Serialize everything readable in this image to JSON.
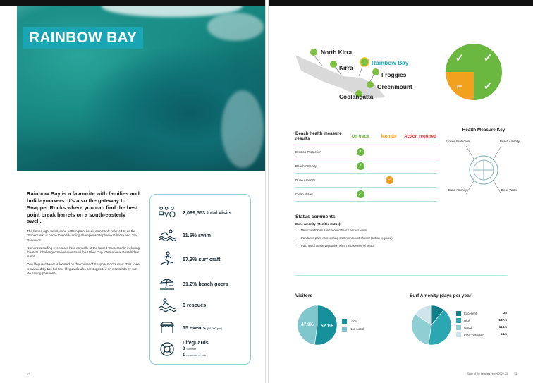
{
  "left_page": {
    "title": "RAINBOW BAY",
    "intro_lead": "Rainbow Bay is a favourite with families and holidaymakers. It’s also the gateway to Snapper Rocks where you can find the best point break barrels on a south-easterly swell.",
    "paragraphs": [
      "The famed right hand, sand-bottom point break commonly referred to as the “Superbank” is home to world-surfing champions Stephanie Gilmore and Joel Parkinson.",
      "Numerous surfing events are held annually at the famed “Superbank” including the WSL Challenger Series event and the Usher Cup International Boardriders event.",
      "One lifeguard tower is located on the corner of Snapper Rocks road. This tower is manned by two full time lifeguards who are supported on weekends by surf life saving personnel."
    ],
    "stats": [
      {
        "icon": "people-icon",
        "text": "2,099,553 total visits",
        "note": ""
      },
      {
        "icon": "swimmer-icon",
        "text": "11.5% swim",
        "note": ""
      },
      {
        "icon": "surfer-icon",
        "text": "57.3% surf craft",
        "note": ""
      },
      {
        "icon": "umbrella-icon",
        "text": "31.2% beach goers",
        "note": ""
      },
      {
        "icon": "rescue-icon",
        "text": "6 rescues",
        "note": ""
      },
      {
        "icon": "event-tent-icon",
        "text": "15 events",
        "note": "(50,000 pax)"
      }
    ],
    "lifeguards": {
      "icon": "lifebuoy-icon",
      "title": "Lifeguards",
      "summer_num": "3",
      "summer_label": "Summer",
      "rest_num": "1",
      "rest_label": "remainder of year"
    },
    "page_number": "12"
  },
  "right_page": {
    "map_labels": [
      "North Kirra",
      "Kirra",
      "Rainbow Bay",
      "Froggies",
      "Greenmount",
      "Coolangatta"
    ],
    "highlight_color": "#1aa5b5",
    "health_table": {
      "headers": [
        "Beach health measure results",
        "On track",
        "Monitor",
        "Action required"
      ],
      "header_colors": [
        "#1b1b1b",
        "#6ab83f",
        "#f2a11e",
        "#e23a3a"
      ],
      "rows": [
        {
          "label": "Erosion Protection",
          "status": "on_track"
        },
        {
          "label": "Beach Amenity",
          "status": "on_track"
        },
        {
          "label": "Dune Amenity",
          "status": "monitor"
        },
        {
          "label": "Clean Water",
          "status": "on_track"
        }
      ]
    },
    "key": {
      "title": "Health Measure Key",
      "labels": [
        "Erosion Protection",
        "Beach Amenity",
        "Dune Amenity",
        "Clean Water"
      ]
    },
    "status": {
      "title": "Status comments",
      "subtitle": "Dune amenity (Monitor status):",
      "items": [
        "Minor windblown sand around beach access ways",
        "Pandanus palm encroaching on Greenmount shower (action required)",
        "Patches of dense vegetation within mid section of beach"
      ]
    },
    "footer": "State of the beaches report 2022-23",
    "page_number": "13"
  },
  "chart_data": [
    {
      "type": "pie",
      "title": "Visitors",
      "categories": [
        "Local",
        "Non Local"
      ],
      "values": [
        52.1,
        47.9
      ],
      "labels": [
        "52.1%",
        "47.9%"
      ],
      "colors": [
        "#16919c",
        "#7fc7cd"
      ]
    },
    {
      "type": "pie",
      "title": "Surf Amenity (days per year)",
      "categories": [
        "Excellent",
        "High",
        "Good",
        "Poor-Average"
      ],
      "values": [
        38,
        147.5,
        113.5,
        54.5
      ],
      "colors": [
        "#0d7f8a",
        "#2ba7b1",
        "#8fcfd4",
        "#cfe3ea"
      ]
    }
  ]
}
